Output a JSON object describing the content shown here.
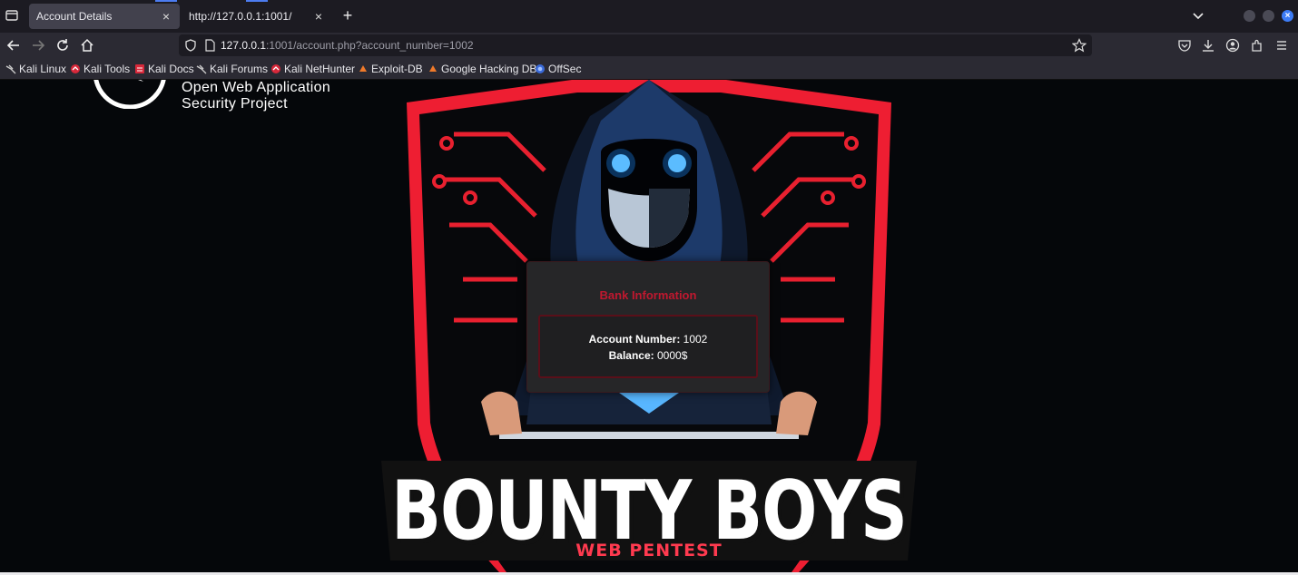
{
  "browser": {
    "tabs": [
      {
        "title": "Account Details",
        "active": true
      },
      {
        "title": "http://127.0.0.1:1001/",
        "active": false
      }
    ],
    "url": {
      "host": "127.0.0.1",
      "rest": ":1001/account.php?account_number=1002"
    },
    "bookmarks": [
      {
        "label": "Kali Linux",
        "icon": "kali-dragon-icon"
      },
      {
        "label": "Kali Tools",
        "icon": "kali-red-icon"
      },
      {
        "label": "Kali Docs",
        "icon": "kali-docs-icon"
      },
      {
        "label": "Kali Forums",
        "icon": "kali-dragon-icon"
      },
      {
        "label": "Kali NetHunter",
        "icon": "kali-red-icon"
      },
      {
        "label": "Exploit-DB",
        "icon": "exploit-db-icon"
      },
      {
        "label": "Google Hacking DB",
        "icon": "exploit-db-icon"
      },
      {
        "label": "OffSec",
        "icon": "offsec-icon"
      }
    ],
    "accent_color": "#3d7cf5"
  },
  "page": {
    "owasp": {
      "line1": "Open Web Application",
      "line2": "Security Project"
    },
    "hero": {
      "title": "BOUNTY BOYS",
      "subtitle": "WEB PENTEST",
      "accent_color": "#ff2a42"
    },
    "bank_card": {
      "heading": "Bank Information",
      "account_label": "Account Number:",
      "account_value": "1002",
      "balance_label": "Balance:",
      "balance_value": "0000$"
    }
  }
}
